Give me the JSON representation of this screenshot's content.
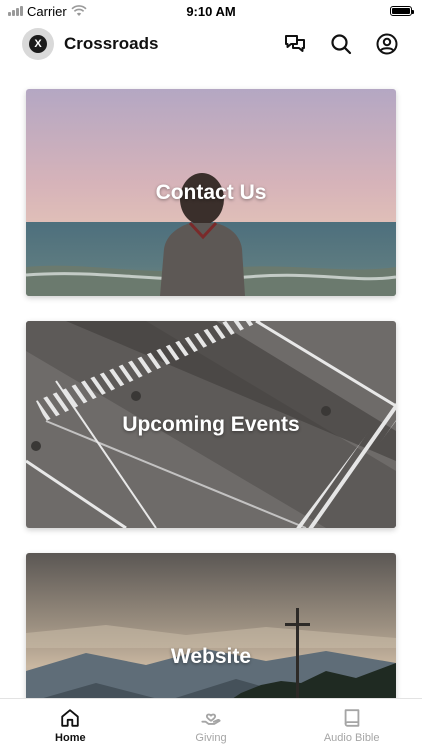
{
  "status_bar": {
    "carrier": "Carrier",
    "time": "9:10 AM"
  },
  "header": {
    "app_name": "Crossroads",
    "logo_glyph": "X",
    "icons": [
      "chat-icon",
      "search-icon",
      "account-icon"
    ]
  },
  "cards": [
    {
      "title": "Contact Us"
    },
    {
      "title": "Upcoming Events"
    },
    {
      "title": "Website"
    }
  ],
  "tabs": [
    {
      "label": "Home",
      "icon": "home-icon",
      "active": true
    },
    {
      "label": "Giving",
      "icon": "giving-icon",
      "active": false
    },
    {
      "label": "Audio Bible",
      "icon": "book-icon",
      "active": false
    }
  ],
  "colors": {
    "active_tab": "#111111",
    "inactive_tab": "#a5a5a5"
  }
}
